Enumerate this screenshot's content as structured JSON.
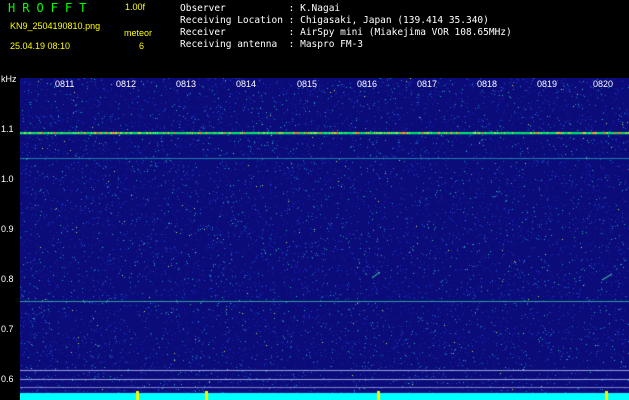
{
  "header": {
    "app_title": "HROFFT",
    "version": "1.00f",
    "file_name": "KN9_2504190810.png",
    "mode": "meteor",
    "datetime": "25.04.19 08:10",
    "count": "6"
  },
  "info": {
    "observer": "Observer           : K.Nagai",
    "location": "Receiving Location : Chigasaki, Japan (139.414 35.340)",
    "receiver": "Receiver           : AirSpy mini (Miakejima VOR 108.65MHz)",
    "antenna": "Receiving antenna  : Maspro FM-3"
  },
  "plot": {
    "y_unit": "kHz",
    "y_ticks": [
      "1.1",
      "1.0",
      "0.9",
      "0.8",
      "0.7",
      "0.6"
    ],
    "time_labels": [
      "0811",
      "0812",
      "0813",
      "0814",
      "0815",
      "0816",
      "0817",
      "0818",
      "0819",
      "0820"
    ],
    "colors": {
      "background": "#0a0a78",
      "carrier": "#00ff80",
      "baseline": "#00ffff"
    }
  }
}
